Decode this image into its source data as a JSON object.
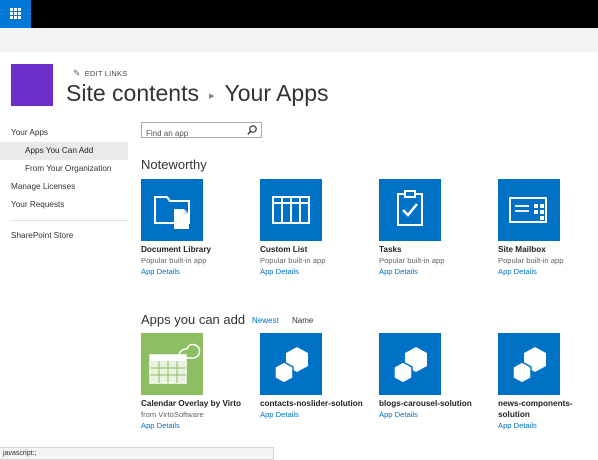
{
  "header": {
    "edit_links": "EDIT LINKS",
    "breadcrumb_root": "Site contents",
    "breadcrumb_current": "Your Apps",
    "logo_color": "#6b2fc9"
  },
  "leftnav": {
    "items": [
      {
        "label": "Your Apps"
      },
      {
        "label": "Apps You Can Add"
      },
      {
        "label": "From Your Organization"
      },
      {
        "label": "Manage Licenses"
      },
      {
        "label": "Your Requests"
      },
      {
        "label": "SharePoint Store"
      }
    ]
  },
  "search": {
    "placeholder": "Find an app"
  },
  "noteworthy": {
    "heading": "Noteworthy",
    "apps": [
      {
        "name": "Document Library",
        "subtitle": "Popular built-in app",
        "details": "App Details",
        "icon": "document-library-icon"
      },
      {
        "name": "Custom List",
        "subtitle": "Popular built-in app",
        "details": "App Details",
        "icon": "custom-list-icon"
      },
      {
        "name": "Tasks",
        "subtitle": "Popular built-in app",
        "details": "App Details",
        "icon": "tasks-icon"
      },
      {
        "name": "Site Mailbox",
        "subtitle": "Popular built-in app",
        "details": "App Details",
        "icon": "site-mailbox-icon"
      }
    ]
  },
  "addable": {
    "heading": "Apps you can add",
    "sort_newest": "Newest",
    "sort_name": "Name",
    "apps": [
      {
        "name": "Calendar Overlay by Virto",
        "subtitle": "from VirtoSoftware",
        "details": "App Details",
        "icon": "calendar-icon"
      },
      {
        "name": "contacts-noslider-solution",
        "details": "App Details",
        "icon": "generic-app-icon"
      },
      {
        "name": "blogs-carousel-solution",
        "details": "App Details",
        "icon": "generic-app-icon"
      },
      {
        "name": "news-components-solution",
        "details": "App Details",
        "icon": "generic-app-icon"
      }
    ]
  },
  "statusbar": {
    "text": "javascript:;"
  },
  "colors": {
    "accent": "#0072c6",
    "suitebar": "#000000",
    "waffle": "#0078d7",
    "calendar_tile": "#8cbf62"
  }
}
